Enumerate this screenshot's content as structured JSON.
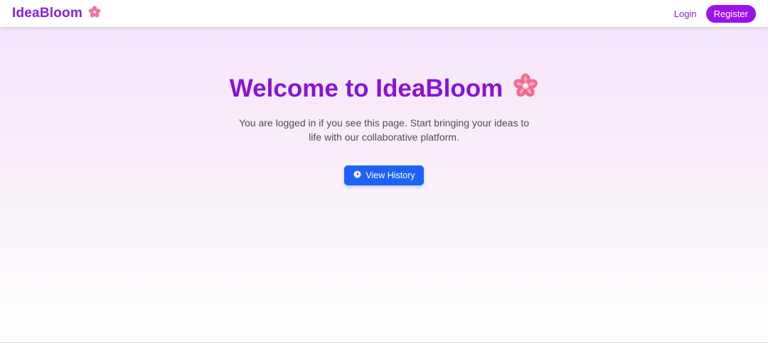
{
  "navbar": {
    "brand": "IdeaBloom",
    "brand_icon": "cherry-blossom-icon",
    "login_label": "Login",
    "register_label": "Register"
  },
  "hero": {
    "title": "Welcome to IdeaBloom",
    "title_icon": "cherry-blossom-icon",
    "subtitle": "You are logged in if you see this page. Start bringing your ideas to life with our collaborative platform.",
    "history_button_label": "View History",
    "history_button_icon": "clock-icon"
  },
  "colors": {
    "brand_purple": "#8a1fd4",
    "register_bg": "#9b13e8",
    "primary_blue": "#1c63f2",
    "flower_pink": "#f06a93"
  }
}
